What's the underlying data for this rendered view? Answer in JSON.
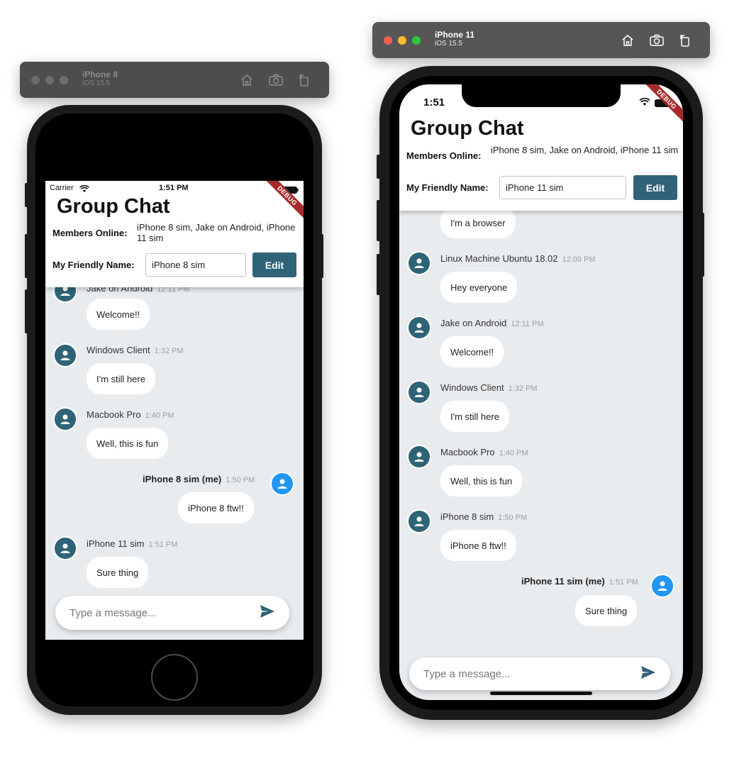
{
  "simulators": [
    {
      "device": "iPhone 8",
      "os": "iOS 15.5"
    },
    {
      "device": "iPhone 11",
      "os": "iOS 15.5"
    }
  ],
  "icons": {
    "home": "home-icon",
    "screenshot": "camera-icon",
    "rotate": "rotate-icon",
    "send": "send-icon",
    "avatar": "person-icon",
    "wifi": "wifi-icon",
    "battery": "battery-icon"
  },
  "colors": {
    "header_button": "#2f6377",
    "avatar_other": "#2f6377",
    "avatar_me": "#2196f3",
    "chat_bg": "#e9ecef",
    "debug_banner": "#a62b2b"
  },
  "phone8": {
    "carrier": "Carrier",
    "time": "1:51 PM",
    "debug": "DEBUG",
    "header": {
      "title": "Group Chat",
      "members_label": "Members Online:",
      "members": "iPhone 8 sim, Jake on Android, iPhone 11 sim",
      "name_label": "My Friendly Name:",
      "name_value": "iPhone 8 sim",
      "edit": "Edit"
    },
    "messages": [
      {
        "sender": "Jake on Android",
        "time": "12:11 PM",
        "text": "Welcome!!",
        "me": false
      },
      {
        "sender": "Windows Client",
        "time": "1:32 PM",
        "text": "I'm still here",
        "me": false
      },
      {
        "sender": "Macbook Pro",
        "time": "1:40 PM",
        "text": "Well, this is fun",
        "me": false
      },
      {
        "sender": "iPhone 8 sim (me)",
        "time": "1:50 PM",
        "text": "iPhone 8 ftw!!",
        "me": true
      },
      {
        "sender": "iPhone 11 sim",
        "time": "1:51 PM",
        "text": "Sure thing",
        "me": false
      }
    ],
    "composer_placeholder": "Type a message..."
  },
  "phone11": {
    "time": "1:51",
    "debug": "DEBUG",
    "header": {
      "title": "Group Chat",
      "members_label": "Members Online:",
      "members": "iPhone 8 sim, Jake on Android, iPhone 11 sim",
      "name_label": "My Friendly Name:",
      "name_value": "iPhone 11 sim",
      "edit": "Edit"
    },
    "messages": [
      {
        "sender": "",
        "time": "",
        "text": "I'm a browser",
        "me": false
      },
      {
        "sender": "Linux Machine Ubuntu 18.02",
        "time": "12:09 PM",
        "text": "Hey everyone",
        "me": false
      },
      {
        "sender": "Jake on Android",
        "time": "12:11 PM",
        "text": "Welcome!!",
        "me": false
      },
      {
        "sender": "Windows Client",
        "time": "1:32 PM",
        "text": "I'm still here",
        "me": false
      },
      {
        "sender": "Macbook Pro",
        "time": "1:40 PM",
        "text": "Well, this is fun",
        "me": false
      },
      {
        "sender": "iPhone 8 sim",
        "time": "1:50 PM",
        "text": "iPhone 8 ftw!!",
        "me": false
      },
      {
        "sender": "iPhone 11 sim (me)",
        "time": "1:51 PM",
        "text": "Sure thing",
        "me": true
      }
    ],
    "composer_placeholder": "Type a message..."
  }
}
